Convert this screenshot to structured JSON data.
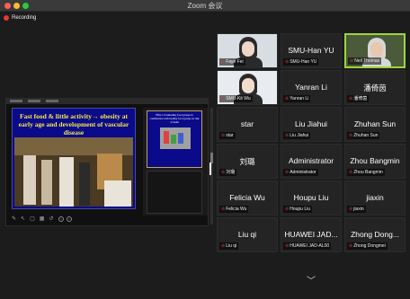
{
  "window": {
    "title": "Zoom 会议"
  },
  "recording": {
    "label": "Recording"
  },
  "share": {
    "slide_title": "Fast food & little activity→ obesity at early age and development of vascular disease",
    "thumb_title": "Effect of unhealthy food groups in combination with healthy food groups on risk of death"
  },
  "gallery": {
    "tiles": [
      {
        "name": "",
        "label": "Faye Fei",
        "video": true
      },
      {
        "name": "SMU-Han YU",
        "label": "SMU-Han YU",
        "video": false
      },
      {
        "name": "",
        "label": "Neil Thomas",
        "video": true,
        "active": true
      },
      {
        "name": "",
        "label": "SMU-Kit Wu",
        "video": true
      },
      {
        "name": "Yanran Li",
        "label": "Yanran Li",
        "video": false
      },
      {
        "name": "潘倚茵",
        "label": "潘倚茵",
        "video": false
      },
      {
        "name": "star",
        "label": "star",
        "video": false
      },
      {
        "name": "Liu Jiahui",
        "label": "Liu Jiahui",
        "video": false
      },
      {
        "name": "Zhuhan Sun",
        "label": "Zhuhan Sun",
        "video": false
      },
      {
        "name": "刘璐",
        "label": "刘璐",
        "video": false
      },
      {
        "name": "Administrator",
        "label": "Administrator",
        "video": false
      },
      {
        "name": "Zhou Bangmin",
        "label": "Zhou Bangmin",
        "video": false
      },
      {
        "name": "Felicia Wu",
        "label": "Felicia Wu",
        "video": false
      },
      {
        "name": "Houpu Liu",
        "label": "Houpu Liu",
        "video": false
      },
      {
        "name": "jiaxin",
        "label": "jiaxin",
        "video": false
      },
      {
        "name": "Liu qi",
        "label": "Liu qi",
        "video": false
      },
      {
        "name": "HUAWEI JAD...",
        "label": "HUAWEI JAD-AL00",
        "video": false
      },
      {
        "name": "Zhong Dong...",
        "label": "Zhong Dongmei",
        "video": false
      }
    ]
  },
  "icons": {
    "mic": "mic-muted-icon",
    "up": "chevron-up-icon",
    "down": "chevron-down-icon"
  },
  "colors": {
    "recording": "#e53935",
    "active_speaker": "#9bd63b",
    "slide_bg": "#0a0a8a",
    "slide_title": "#f5e94a"
  }
}
